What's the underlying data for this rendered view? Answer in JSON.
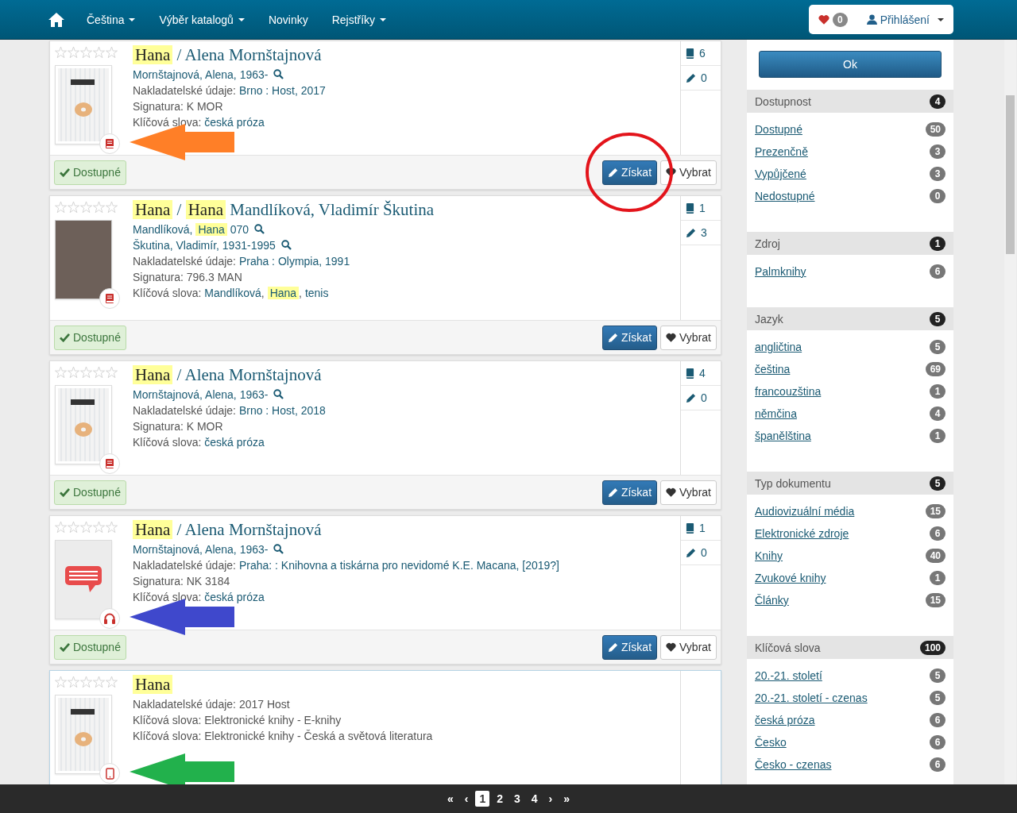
{
  "nav": {
    "items": [
      {
        "label": "Čeština",
        "dropdown": true
      },
      {
        "label": "Výběr katalogů",
        "dropdown": true
      },
      {
        "label": "Novinky",
        "dropdown": false
      },
      {
        "label": "Rejstříky",
        "dropdown": true
      }
    ],
    "favorites_count": "0",
    "login": {
      "label": "Přihlášení",
      "dropdown": true
    }
  },
  "records": [
    {
      "selected": false,
      "stars": 0,
      "cover": {
        "kind": "book"
      },
      "format_badge": {
        "kind": "book"
      },
      "arrow": {
        "color": "#ff7f27"
      },
      "circle_on_get": true,
      "title": [
        {
          "text": "Hana",
          "highlight": true
        },
        {
          "text": " / Alena Mornštajnová",
          "highlight": false
        }
      ],
      "lines": [
        {
          "kind": "author",
          "parts": [
            {
              "text": "Mornštajnová, Alena, 1963-",
              "link": true,
              "highlight": false
            }
          ]
        },
        {
          "kind": "field",
          "label": "Nakladatelské údaje:",
          "parts": [
            {
              "text": "Brno : Host, 2017",
              "link": true,
              "highlight": false
            }
          ]
        },
        {
          "kind": "field",
          "label": "Signatura:",
          "parts": [
            {
              "text": "K MOR",
              "link": false,
              "highlight": false
            }
          ]
        },
        {
          "kind": "field",
          "label": "Klíčová slova:",
          "parts": [
            {
              "text": "česká próza",
              "link": true,
              "highlight": false
            }
          ]
        }
      ],
      "counts": {
        "copies": "6",
        "reviews": "0"
      },
      "buttons": [
        {
          "kind": "status",
          "text": "Dostupné"
        },
        {
          "kind": "get",
          "text": "Získat"
        },
        {
          "kind": "select",
          "text": "Vybrat"
        }
      ]
    },
    {
      "selected": false,
      "stars": 0,
      "cover": {
        "kind": "photo"
      },
      "format_badge": {
        "kind": "book"
      },
      "circle_on_get": false,
      "title": [
        {
          "text": "Hana",
          "highlight": true
        },
        {
          "text": " / ",
          "highlight": false
        },
        {
          "text": "Hana",
          "highlight": true
        },
        {
          "text": " Mandlíková, Vladimír Škutina",
          "highlight": false
        }
      ],
      "lines": [
        {
          "kind": "author",
          "parts": [
            {
              "text": "Mandlíková, ",
              "link": true,
              "highlight": false
            },
            {
              "text": "Hana",
              "link": true,
              "highlight": true
            },
            {
              "text": " 070",
              "link": true,
              "highlight": false
            }
          ]
        },
        {
          "kind": "author",
          "parts": [
            {
              "text": "Škutina, Vladimír, 1931-1995",
              "link": true,
              "highlight": false
            }
          ]
        },
        {
          "kind": "field",
          "label": "Nakladatelské údaje:",
          "parts": [
            {
              "text": "Praha : Olympia, 1991",
              "link": true,
              "highlight": false
            }
          ]
        },
        {
          "kind": "field",
          "label": "Signatura:",
          "parts": [
            {
              "text": "796.3 MAN",
              "link": false,
              "highlight": false
            }
          ]
        },
        {
          "kind": "field",
          "label": "Klíčová slova:",
          "parts": [
            {
              "text": "Mandlíková",
              "link": true,
              "highlight": false
            },
            {
              "text": ", ",
              "link": false,
              "highlight": false
            },
            {
              "text": "Hana",
              "link": true,
              "highlight": true
            },
            {
              "text": ", ",
              "link": false,
              "highlight": false
            },
            {
              "text": "tenis",
              "link": true,
              "highlight": false
            }
          ]
        }
      ],
      "counts": {
        "copies": "1",
        "reviews": "3"
      },
      "buttons": [
        {
          "kind": "status",
          "text": "Dostupné"
        },
        {
          "kind": "get",
          "text": "Získat"
        },
        {
          "kind": "select",
          "text": "Vybrat"
        }
      ]
    },
    {
      "selected": false,
      "stars": 0,
      "cover": {
        "kind": "book"
      },
      "format_badge": {
        "kind": "book"
      },
      "circle_on_get": false,
      "title": [
        {
          "text": "Hana",
          "highlight": true
        },
        {
          "text": " / Alena Mornštajnová",
          "highlight": false
        }
      ],
      "lines": [
        {
          "kind": "author",
          "parts": [
            {
              "text": "Mornštajnová, Alena, 1963-",
              "link": true,
              "highlight": false
            }
          ]
        },
        {
          "kind": "field",
          "label": "Nakladatelské údaje:",
          "parts": [
            {
              "text": "Brno : Host, 2018",
              "link": true,
              "highlight": false
            }
          ]
        },
        {
          "kind": "field",
          "label": "Signatura:",
          "parts": [
            {
              "text": "K MOR",
              "link": false,
              "highlight": false
            }
          ]
        },
        {
          "kind": "field",
          "label": "Klíčová slova:",
          "parts": [
            {
              "text": "česká próza",
              "link": true,
              "highlight": false
            }
          ]
        }
      ],
      "counts": {
        "copies": "4",
        "reviews": "0"
      },
      "buttons": [
        {
          "kind": "status",
          "text": "Dostupné"
        },
        {
          "kind": "get",
          "text": "Získat"
        },
        {
          "kind": "select",
          "text": "Vybrat"
        }
      ]
    },
    {
      "selected": false,
      "stars": 0,
      "cover": {
        "kind": "audio"
      },
      "format_badge": {
        "kind": "audio"
      },
      "arrow": {
        "color": "#3f48cc"
      },
      "circle_on_get": false,
      "title": [
        {
          "text": "Hana",
          "highlight": true
        },
        {
          "text": " / Alena Mornštajnová",
          "highlight": false
        }
      ],
      "lines": [
        {
          "kind": "author",
          "parts": [
            {
              "text": "Mornštajnová, Alena, 1963-",
              "link": true,
              "highlight": false
            }
          ]
        },
        {
          "kind": "field",
          "label": "Nakladatelské údaje:",
          "parts": [
            {
              "text": "Praha: : Knihovna a tiskárna pro nevidomé K.E. Macana, [2019?]",
              "link": true,
              "highlight": false
            }
          ]
        },
        {
          "kind": "field",
          "label": "Signatura:",
          "parts": [
            {
              "text": "NK 3184",
              "link": false,
              "highlight": false
            }
          ]
        },
        {
          "kind": "field",
          "label": "Klíčová slova:",
          "parts": [
            {
              "text": "česká próza",
              "link": true,
              "highlight": false
            }
          ]
        }
      ],
      "counts": {
        "copies": "1",
        "reviews": "0"
      },
      "buttons": [
        {
          "kind": "status",
          "text": "Dostupné"
        },
        {
          "kind": "get",
          "text": "Získat"
        },
        {
          "kind": "select",
          "text": "Vybrat"
        }
      ]
    },
    {
      "selected": true,
      "stars": 0,
      "cover": {
        "kind": "book"
      },
      "format_badge": {
        "kind": "ebook"
      },
      "arrow": {
        "color": "#22b14c"
      },
      "title": [
        {
          "text": "Hana",
          "highlight": true
        }
      ],
      "lines": [
        {
          "kind": "field",
          "label": "Nakladatelské údaje:",
          "parts": [
            {
              "text": "2017 Host",
              "link": false,
              "highlight": false
            }
          ]
        },
        {
          "kind": "field",
          "label": "Klíčová slova:",
          "parts": [
            {
              "text": "Elektronické knihy - E-knihy",
              "link": false,
              "highlight": false
            }
          ]
        },
        {
          "kind": "field",
          "label": "Klíčová slova:",
          "parts": [
            {
              "text": "Elektronické knihy - Česká a světová literatura",
              "link": false,
              "highlight": false
            }
          ]
        }
      ]
    }
  ],
  "sidebar": {
    "ok_button": "Ok",
    "facets": [
      {
        "title": "Dostupnost",
        "count": "4",
        "items": [
          {
            "label": "Dostupné",
            "count": "50"
          },
          {
            "label": "Prezenčně",
            "count": "3"
          },
          {
            "label": "Vypůjčené",
            "count": "3"
          },
          {
            "label": "Nedostupné",
            "count": "0"
          }
        ]
      },
      {
        "title": "Zdroj",
        "count": "1",
        "items": [
          {
            "label": "Palmknihy",
            "count": "6"
          }
        ]
      },
      {
        "title": "Jazyk",
        "count": "5",
        "items": [
          {
            "label": "angličtina",
            "count": "5"
          },
          {
            "label": "čeština",
            "count": "69"
          },
          {
            "label": "francouzština",
            "count": "1"
          },
          {
            "label": "němčina",
            "count": "4"
          },
          {
            "label": "španělština",
            "count": "1"
          }
        ]
      },
      {
        "title": "Typ dokumentu",
        "count": "5",
        "items": [
          {
            "label": "Audiovizuální média",
            "count": "15"
          },
          {
            "label": "Elektronické zdroje",
            "count": "6"
          },
          {
            "label": "Knihy",
            "count": "40"
          },
          {
            "label": "Zvukové knihy",
            "count": "1"
          },
          {
            "label": "Články",
            "count": "15"
          }
        ]
      },
      {
        "title": "Klíčová slova",
        "count": "100",
        "items": [
          {
            "label": "20.-21. století",
            "count": "5"
          },
          {
            "label": "20.-21. století - czenas",
            "count": "5"
          },
          {
            "label": "česká próza",
            "count": "6"
          },
          {
            "label": "Česko",
            "count": "6"
          },
          {
            "label": "Česko - czenas",
            "count": "6"
          }
        ]
      }
    ]
  },
  "pagination": [
    {
      "text": "«",
      "selected": false
    },
    {
      "text": "‹",
      "selected": false
    },
    {
      "text": "1",
      "selected": true
    },
    {
      "text": "2",
      "selected": false
    },
    {
      "text": "3",
      "selected": false
    },
    {
      "text": "4",
      "selected": false
    },
    {
      "text": "›",
      "selected": false
    },
    {
      "text": "»",
      "selected": false
    }
  ]
}
